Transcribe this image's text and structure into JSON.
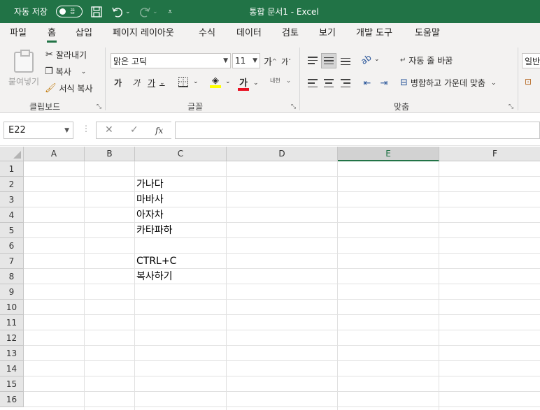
{
  "titlebar": {
    "autosave_label": "자동 저장",
    "autosave_toggle": "끔",
    "save_icon": "save-icon",
    "undo_icon": "undo-icon",
    "redo_icon": "redo-icon",
    "customize_icon": "customize-qat-icon",
    "title": "통합 문서1  -  Excel",
    "bg_color": "#217346"
  },
  "tabs": [
    "파일",
    "홈",
    "삽입",
    "페이지 레이아웃",
    "수식",
    "데이터",
    "검토",
    "보기",
    "개발 도구",
    "도움말"
  ],
  "active_tab": "홈",
  "ribbon": {
    "clipboard": {
      "paste": "붙여넣기",
      "cut": "잘라내기",
      "copy": "복사",
      "format_painter": "서식 복사",
      "label": "클립보드"
    },
    "font": {
      "font_name": "맑은 고딕",
      "font_size": "11",
      "grow": "가",
      "shrink": "가",
      "bold": "가",
      "italic": "가",
      "underline": "가",
      "font_color_glyph": "가",
      "phonetic": "내천",
      "label": "글꼴"
    },
    "alignment": {
      "wrap_text": "자동 줄 바꿈",
      "merge_center": "병합하고 가운데 맞춤",
      "label": "맞춤"
    },
    "number": {
      "format": "일반"
    }
  },
  "formula_bar": {
    "name_box": "E22",
    "cancel": "✕",
    "enter": "✓",
    "fx": "fx",
    "formula": ""
  },
  "sheet": {
    "columns": [
      "A",
      "B",
      "C",
      "D",
      "E",
      "F"
    ],
    "selected_column": "E",
    "rows": [
      "1",
      "2",
      "3",
      "4",
      "5",
      "6",
      "7",
      "8",
      "9",
      "10",
      "11",
      "12",
      "13",
      "14",
      "15",
      "16"
    ],
    "cells": [
      {
        "ref": "C2",
        "value": "가나다"
      },
      {
        "ref": "C3",
        "value": "마바사"
      },
      {
        "ref": "C4",
        "value": "아자차"
      },
      {
        "ref": "C5",
        "value": "카타파하"
      },
      {
        "ref": "C7",
        "value": "CTRL+C"
      },
      {
        "ref": "C8",
        "value": "복사하기"
      }
    ]
  }
}
